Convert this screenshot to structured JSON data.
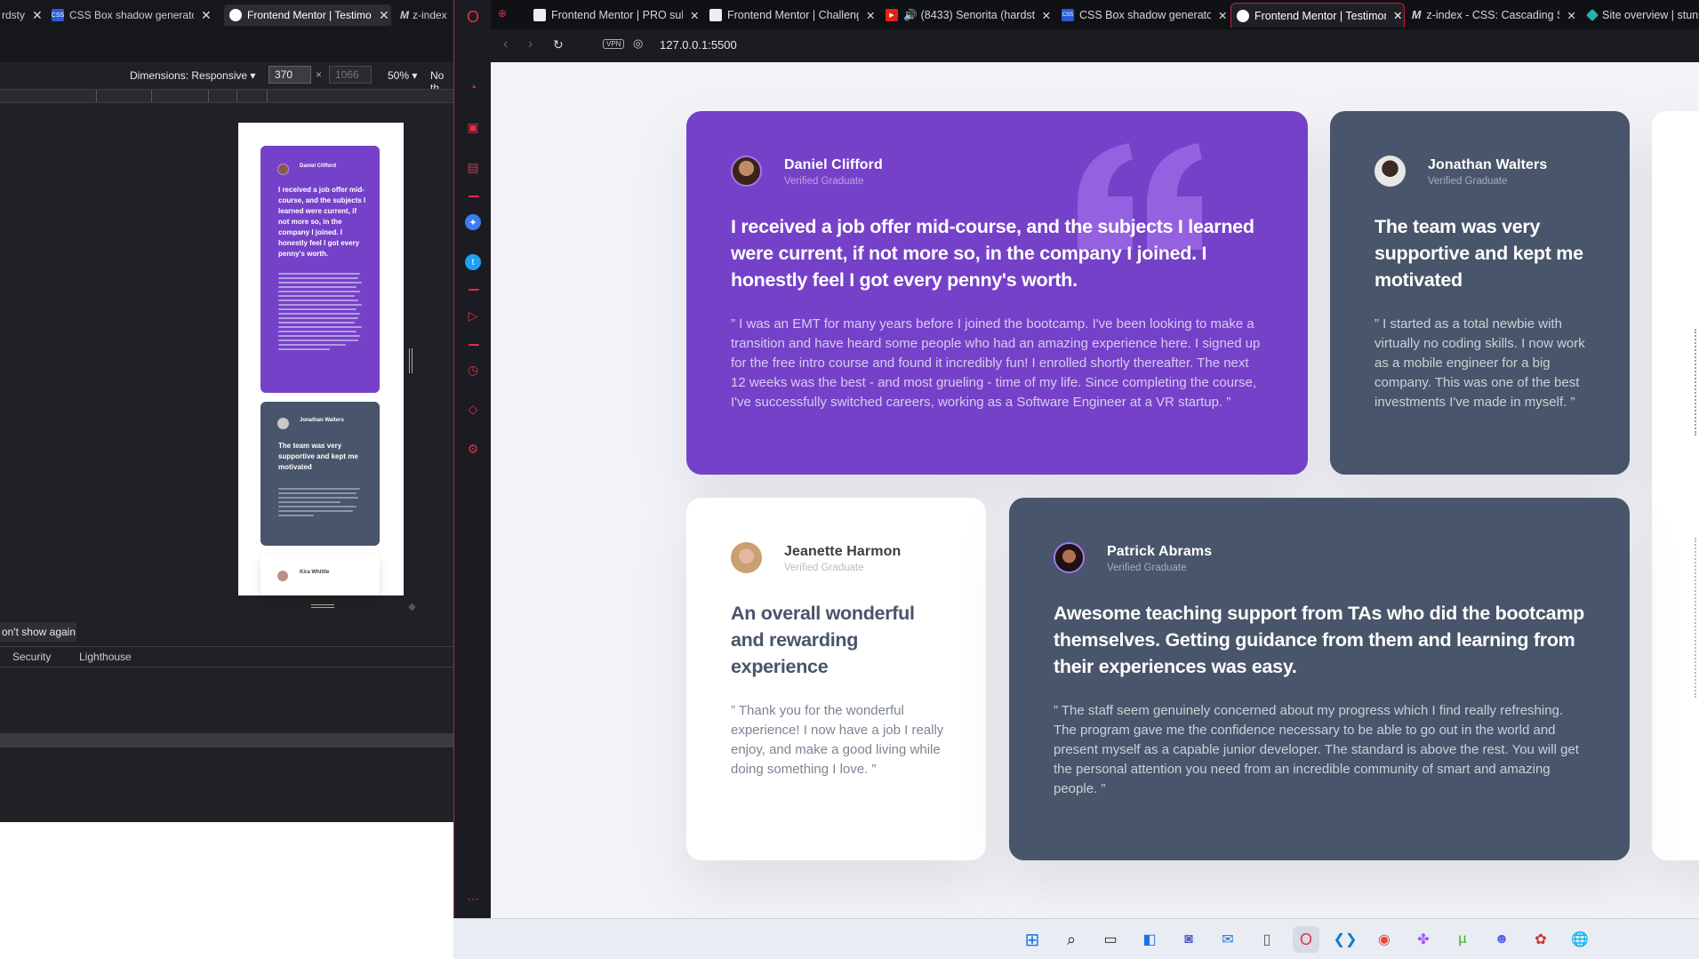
{
  "devtools": {
    "tabs": [
      {
        "label": "rdsty",
        "active": false
      },
      {
        "label": "CSS Box shadow generator",
        "active": false
      },
      {
        "label": "Frontend Mentor | Testimon",
        "active": true
      },
      {
        "label": "z-index",
        "active": false
      }
    ],
    "dimensions_label": "Dimensions: Responsive",
    "width_value": "370",
    "height_placeholder": "1066",
    "zoom": "50%",
    "throttle_partial": "No th",
    "dont_show_again": "on't show again",
    "panel_tabs": [
      "Security",
      "Lighthouse"
    ]
  },
  "mobile_preview": {
    "card1": {
      "name": "Daniel Clifford",
      "heading": "I received a job offer mid-course, and the subjects I learned were current, if not more so, in the company I joined. I honestly feel I got every penny's worth."
    },
    "card2": {
      "name": "Jonathan Walters",
      "heading": "The team was very supportive and kept me motivated"
    },
    "card3": {
      "name": "Kira Whittle"
    }
  },
  "browser": {
    "tabs": [
      {
        "label": "Frontend Mentor | PRO sub",
        "icon": "fm-icon",
        "active": false
      },
      {
        "label": "Frontend Mentor | Challeng",
        "icon": "fm-icon",
        "active": false
      },
      {
        "label": "(8433) Senorita (hardsty",
        "icon": "youtube-icon",
        "active": false
      },
      {
        "label": "CSS Box shadow generator",
        "icon": "css-icon",
        "active": false
      },
      {
        "label": "Frontend Mentor | Testimon",
        "icon": "fm-icon",
        "active": true
      },
      {
        "label": "z-index - CSS: Cascading St",
        "icon": "mdn-icon",
        "active": false
      },
      {
        "label": "Site overview | stunn",
        "icon": "netlify-icon",
        "active": false
      }
    ],
    "url": "127.0.0.1:5500",
    "vpn_label": "VPN"
  },
  "testimonials": [
    {
      "name": "Daniel Clifford",
      "status": "Verified Graduate",
      "heading": "I received a job offer mid-course, and the subjects I learned were current, if not more so, in the company I joined. I honestly feel I got every penny's worth.",
      "body": "” I was an EMT for many years before I joined the bootcamp. I've been looking to make a transition and have heard some people who had an amazing experience here. I signed up for the free intro course and found it incredibly fun! I enrolled shortly thereafter. The next 12 weeks was the best - and most grueling - time of my life. Since completing the course, I've successfully switched careers, working as a Software Engineer at a VR startup. ”",
      "bg": "#7541c8"
    },
    {
      "name": "Jonathan Walters",
      "status": "Verified Graduate",
      "heading": "The team was very supportive and kept me motivated",
      "body": "” I started as a total newbie with virtually no coding skills. I now work as a mobile engineer for a big company. This was one of the best investments I've made in myself. ”",
      "bg": "#48556a"
    },
    {
      "name": "Jeanette Harmon",
      "status": "Verified Graduate",
      "heading": "An overall wonderful and rewarding experience",
      "body": "” Thank you for the wonderful experience! I now have a job I really enjoy, and make a good living while doing something I love. ”",
      "bg": "#ffffff"
    },
    {
      "name": "Patrick Abrams",
      "status": "Verified Graduate",
      "heading": "Awesome teaching support from TAs who did the bootcamp themselves. Getting guidance from them and learning from their experiences was easy.",
      "body": "” The staff seem genuinely concerned about my progress which I find really refreshing. The program gave me the confidence necessary to be able to go out in the world and present myself as a capable junior developer. The standard is above the rest. You will get the personal attention you need from an incredible community of smart and amazing people. ”",
      "bg": "#48556a"
    }
  ],
  "colors": {
    "accent": "#c0213e",
    "purple": "#7541c8",
    "slate": "#48556a",
    "page_bg": "#f3f3f7"
  }
}
